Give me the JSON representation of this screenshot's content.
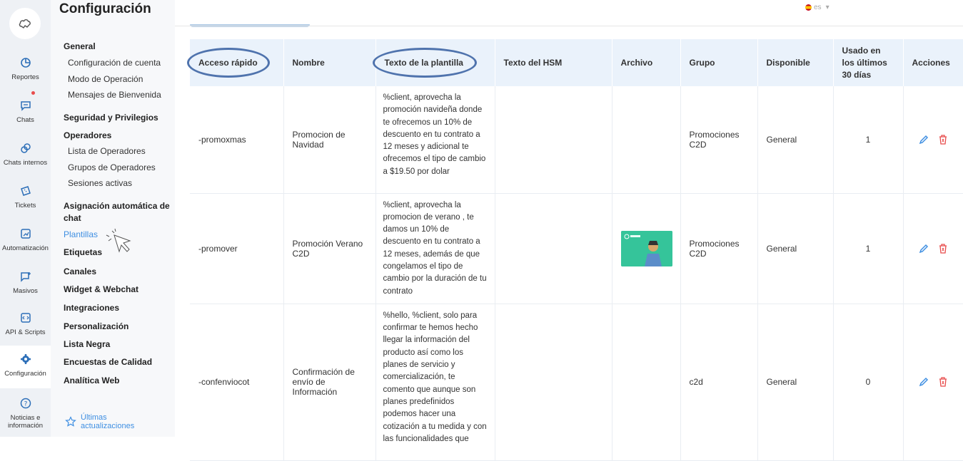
{
  "rail": {
    "items": [
      {
        "label": "Reportes",
        "icon": "pie-chart-icon"
      },
      {
        "label": "Chats",
        "icon": "chat-bubble-icon"
      },
      {
        "label": "Chats internos",
        "icon": "link-chat-icon"
      },
      {
        "label": "Tickets",
        "icon": "ticket-icon"
      },
      {
        "label": "Automatización",
        "icon": "automation-icon"
      },
      {
        "label": "Masivos",
        "icon": "broadcast-icon"
      },
      {
        "label": "API & Scripts",
        "icon": "code-icon"
      },
      {
        "label": "Configuración",
        "icon": "gear-icon"
      },
      {
        "label": "Noticias e información",
        "icon": "help-circle-icon"
      }
    ]
  },
  "menu": {
    "title": "Configuración",
    "general": "General",
    "config_cuenta": "Configuración de cuenta",
    "modo_operacion": "Modo de Operación",
    "mensajes_bienvenida": "Mensajes de Bienvenida",
    "seguridad": "Seguridad y Privilegios",
    "operadores": "Operadores",
    "lista_operadores": "Lista de Operadores",
    "grupos_operadores": "Grupos de Operadores",
    "sesiones": "Sesiones activas",
    "asignacion": "Asignación automática de chat",
    "plantillas": "Plantillas",
    "etiquetas": "Etiquetas",
    "canales": "Canales",
    "widget": "Widget & Webchat",
    "integraciones": "Integraciones",
    "personalizacion": "Personalización",
    "lista_negra": "Lista Negra",
    "encuestas": "Encuestas de Calidad",
    "analitica": "Analítica Web",
    "latest": "Últimas actualizaciones"
  },
  "topbar": {
    "lang": "es"
  },
  "table": {
    "headers": {
      "acceso": "Acceso rápido",
      "nombre": "Nombre",
      "texto": "Texto de la plantilla",
      "hsm": "Texto del HSM",
      "archivo": "Archivo",
      "grupo": "Grupo",
      "disponible": "Disponible",
      "usado": "Usado en los últimos 30 días",
      "acciones": "Acciones"
    },
    "rows": [
      {
        "acceso": "-promoxmas",
        "nombre": "Promocion de Navidad",
        "texto": "%client, aprovecha la promoción navideña donde te ofrecemos un 10% de descuento en tu contrato a 12 meses y adicional te ofrecemos el tipo de cambio a $19.50 por dolar",
        "hsm": "",
        "grupo": "Promociones C2D",
        "disponible": "General",
        "usado": "1"
      },
      {
        "acceso": "-promover",
        "nombre": "Promoción Verano C2D",
        "texto": "%client, aprovecha la promocion de verano , te damos un 10% de descuento en tu contrato a 12 meses, además de que congelamos el tipo de cambio por la duración de tu contrato",
        "hsm": "",
        "grupo": "Promociones C2D",
        "disponible": "General",
        "usado": "1"
      },
      {
        "acceso": "-confenviocot",
        "nombre": "Confirmación de envío de Información",
        "texto": "%hello, %client, solo para confirmar te hemos hecho llegar la información del producto así como los planes de servicio y comercialización, te comento que aunque son planes predefinidos podemos hacer una cotización a tu medida y con las funcionalidades que",
        "hsm": "",
        "grupo": "c2d",
        "disponible": "General",
        "usado": "0"
      }
    ]
  },
  "colors": {
    "accent": "#3f8fe2",
    "delete": "#e84c4c",
    "header_bg": "#eaf2fb",
    "annotation": "#4f73ad"
  }
}
